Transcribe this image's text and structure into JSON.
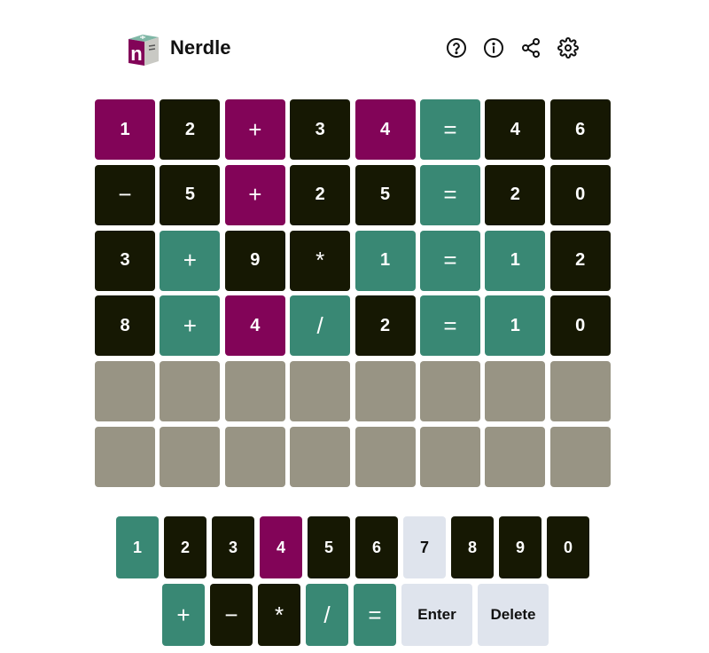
{
  "app": {
    "title": "Nerdle"
  },
  "colors": {
    "correct": "#398874",
    "present": "#820458",
    "absent": "#161803",
    "empty": "#989484",
    "unused_key": "#dfe4ed"
  },
  "header_icons": [
    "help-icon",
    "info-icon",
    "share-icon",
    "settings-icon"
  ],
  "board": {
    "rows": [
      [
        {
          "char": "1",
          "state": "present"
        },
        {
          "char": "2",
          "state": "absent"
        },
        {
          "char": "+",
          "state": "present"
        },
        {
          "char": "3",
          "state": "absent"
        },
        {
          "char": "4",
          "state": "present"
        },
        {
          "char": "=",
          "state": "correct"
        },
        {
          "char": "4",
          "state": "absent"
        },
        {
          "char": "6",
          "state": "absent"
        }
      ],
      [
        {
          "char": "−",
          "state": "absent"
        },
        {
          "char": "5",
          "state": "absent"
        },
        {
          "char": "+",
          "state": "present"
        },
        {
          "char": "2",
          "state": "absent"
        },
        {
          "char": "5",
          "state": "absent"
        },
        {
          "char": "=",
          "state": "correct"
        },
        {
          "char": "2",
          "state": "absent"
        },
        {
          "char": "0",
          "state": "absent"
        }
      ],
      [
        {
          "char": "3",
          "state": "absent"
        },
        {
          "char": "+",
          "state": "correct"
        },
        {
          "char": "9",
          "state": "absent"
        },
        {
          "char": "*",
          "state": "absent"
        },
        {
          "char": "1",
          "state": "correct"
        },
        {
          "char": "=",
          "state": "correct"
        },
        {
          "char": "1",
          "state": "correct"
        },
        {
          "char": "2",
          "state": "absent"
        }
      ],
      [
        {
          "char": "8",
          "state": "absent"
        },
        {
          "char": "+",
          "state": "correct"
        },
        {
          "char": "4",
          "state": "present"
        },
        {
          "char": "/",
          "state": "correct"
        },
        {
          "char": "2",
          "state": "absent"
        },
        {
          "char": "=",
          "state": "correct"
        },
        {
          "char": "1",
          "state": "correct"
        },
        {
          "char": "0",
          "state": "absent"
        }
      ],
      [
        {
          "char": "",
          "state": "empty"
        },
        {
          "char": "",
          "state": "empty"
        },
        {
          "char": "",
          "state": "empty"
        },
        {
          "char": "",
          "state": "empty"
        },
        {
          "char": "",
          "state": "empty"
        },
        {
          "char": "",
          "state": "empty"
        },
        {
          "char": "",
          "state": "empty"
        },
        {
          "char": "",
          "state": "empty"
        }
      ],
      [
        {
          "char": "",
          "state": "empty"
        },
        {
          "char": "",
          "state": "empty"
        },
        {
          "char": "",
          "state": "empty"
        },
        {
          "char": "",
          "state": "empty"
        },
        {
          "char": "",
          "state": "empty"
        },
        {
          "char": "",
          "state": "empty"
        },
        {
          "char": "",
          "state": "empty"
        },
        {
          "char": "",
          "state": "empty"
        }
      ]
    ]
  },
  "keyboard": {
    "rows": [
      [
        {
          "label": "1",
          "state": "correct"
        },
        {
          "label": "2",
          "state": "absent"
        },
        {
          "label": "3",
          "state": "absent"
        },
        {
          "label": "4",
          "state": "present"
        },
        {
          "label": "5",
          "state": "absent"
        },
        {
          "label": "6",
          "state": "absent"
        },
        {
          "label": "7",
          "state": "unused"
        },
        {
          "label": "8",
          "state": "absent"
        },
        {
          "label": "9",
          "state": "absent"
        },
        {
          "label": "0",
          "state": "absent"
        }
      ],
      [
        {
          "label": "+",
          "state": "correct"
        },
        {
          "label": "−",
          "state": "absent"
        },
        {
          "label": "*",
          "state": "absent"
        },
        {
          "label": "/",
          "state": "correct"
        },
        {
          "label": "=",
          "state": "correct"
        },
        {
          "label": "Enter",
          "state": "unused"
        },
        {
          "label": "Delete",
          "state": "unused"
        }
      ]
    ]
  }
}
